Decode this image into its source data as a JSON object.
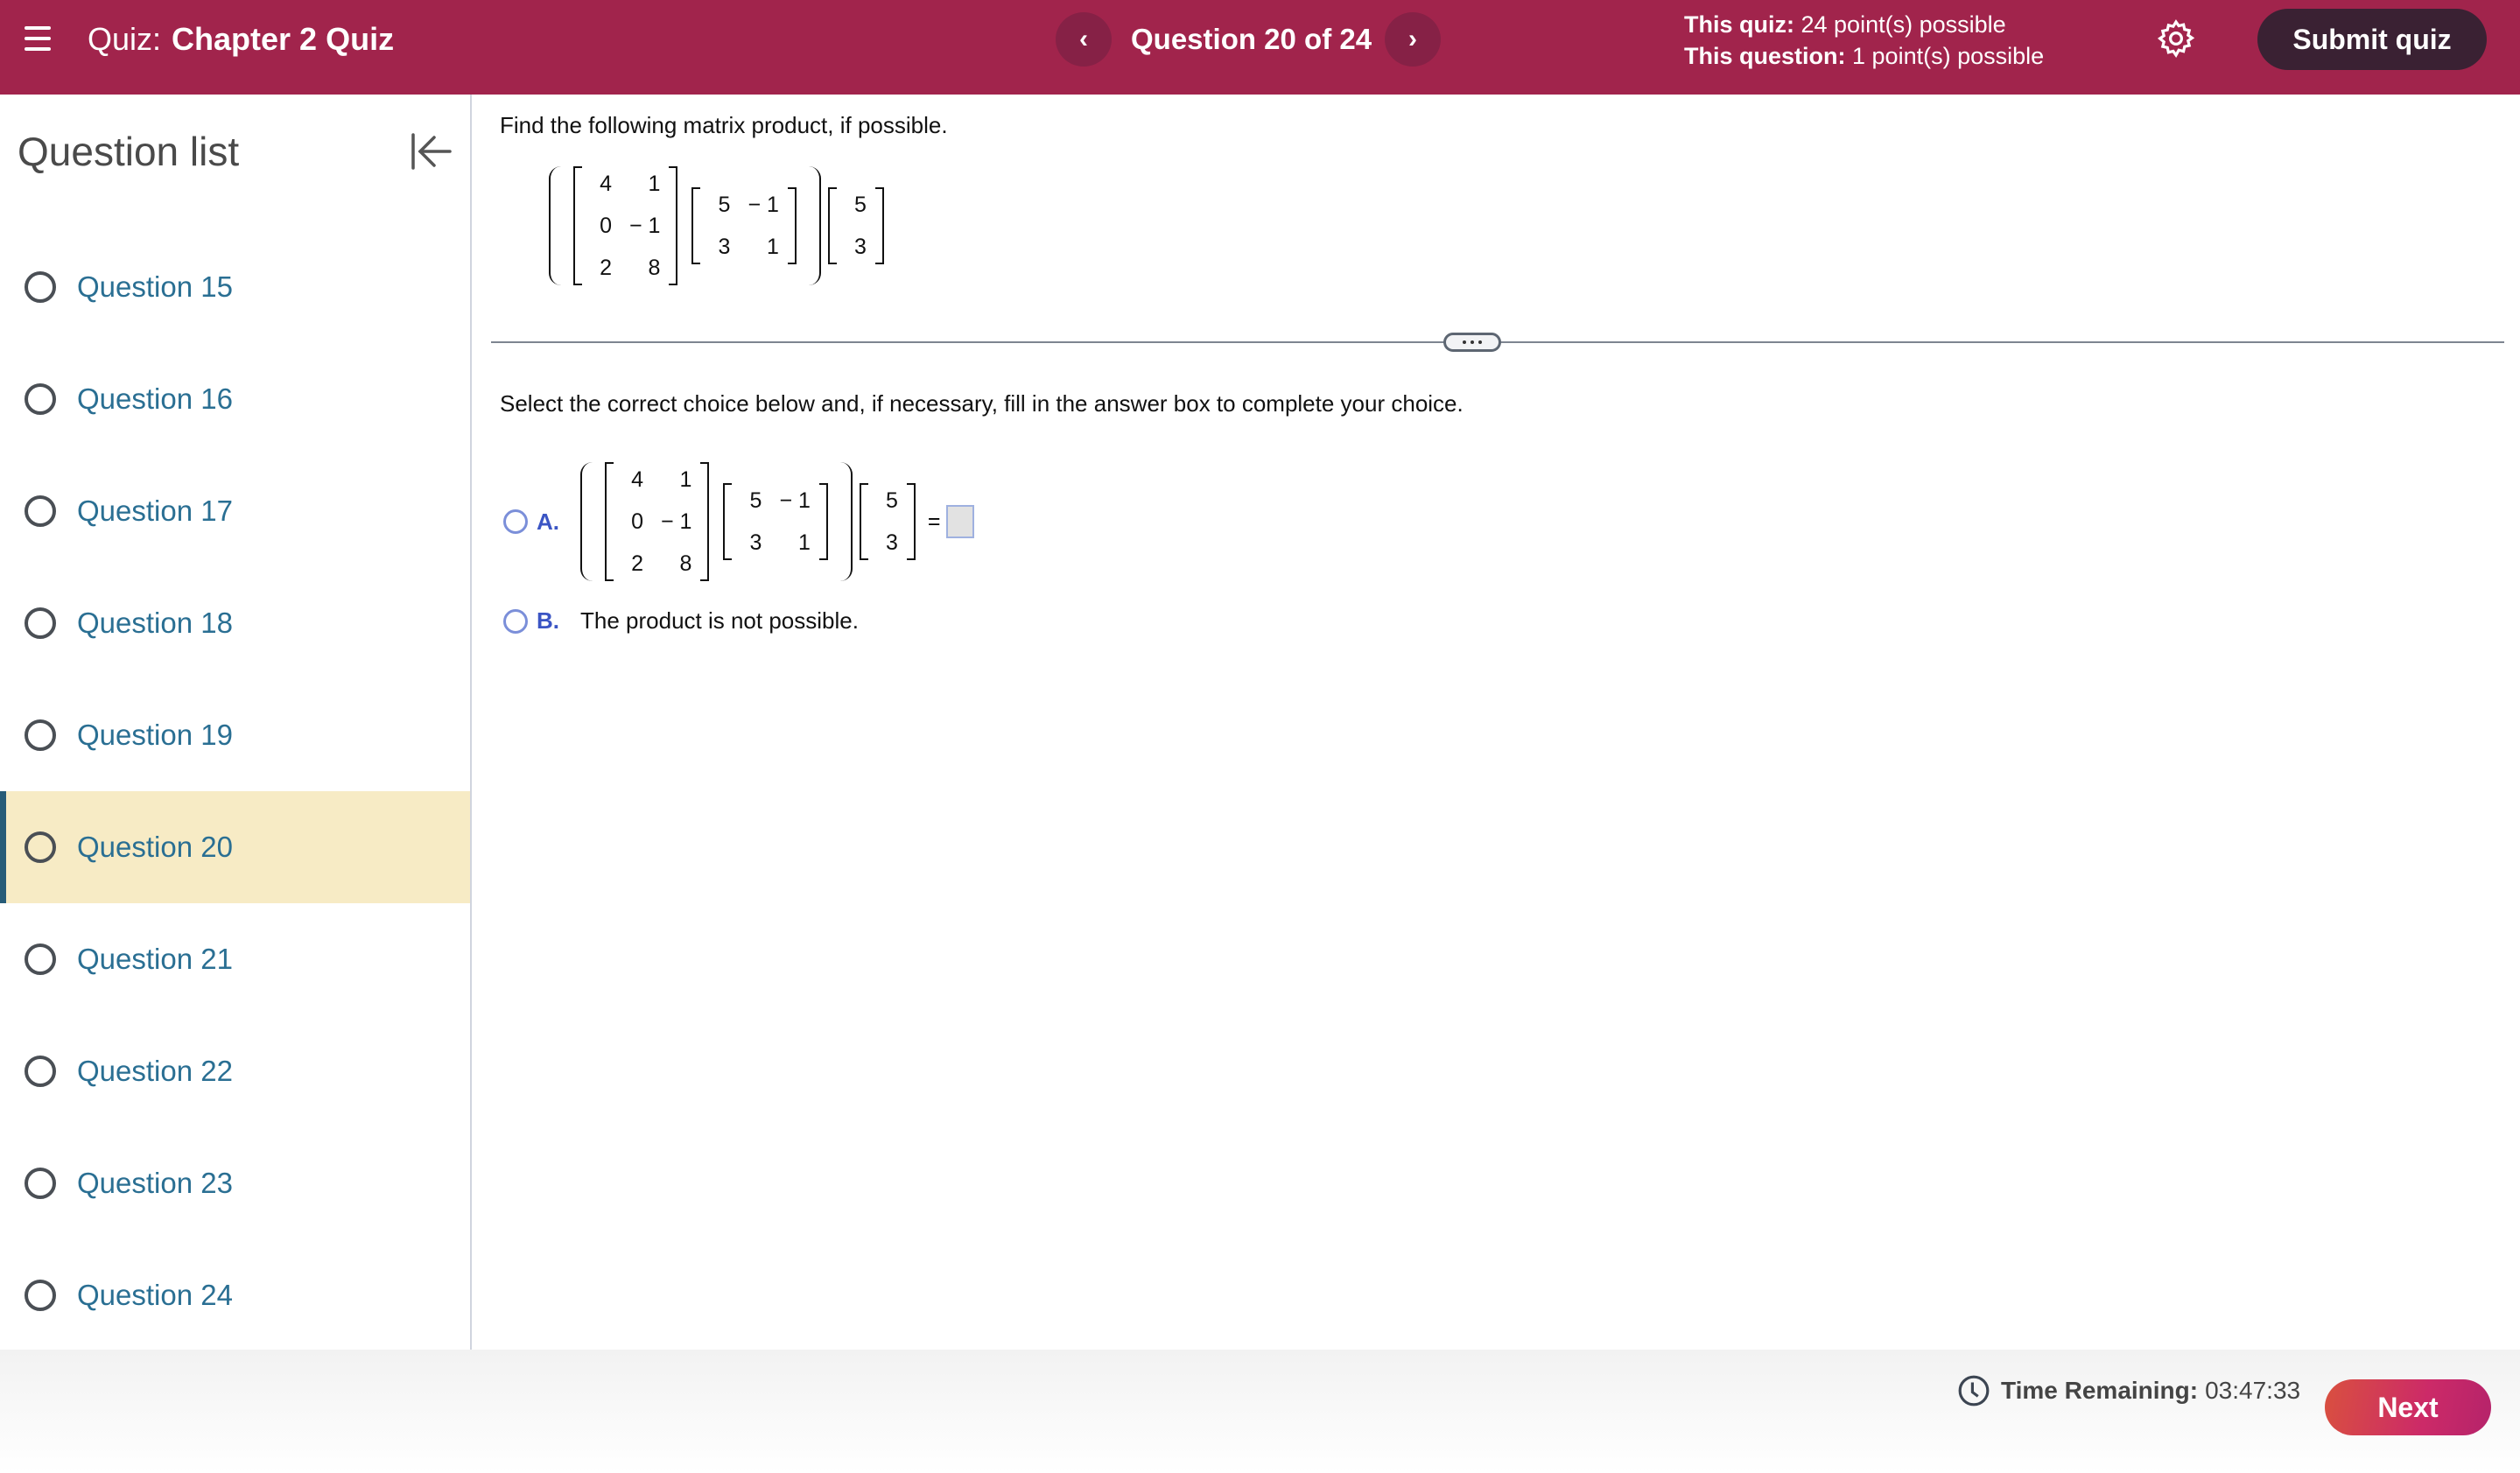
{
  "header": {
    "quiz_label": "Quiz:",
    "quiz_name": "Chapter 2 Quiz",
    "question_counter": "Question 20 of 24",
    "prev_glyph": "‹",
    "next_glyph": "›",
    "this_quiz_label": "This quiz:",
    "this_quiz_value": "24 point(s) possible",
    "this_question_label": "This question:",
    "this_question_value": "1 point(s) possible",
    "submit_label": "Submit quiz",
    "colors": {
      "bar": "#a1244c",
      "submit_bg": "#3a2133"
    }
  },
  "sidebar": {
    "title": "Question list",
    "items": [
      {
        "label": "Question 15",
        "active": false
      },
      {
        "label": "Question 16",
        "active": false
      },
      {
        "label": "Question 17",
        "active": false
      },
      {
        "label": "Question 18",
        "active": false
      },
      {
        "label": "Question 19",
        "active": false
      },
      {
        "label": "Question 20",
        "active": true
      },
      {
        "label": "Question 21",
        "active": false
      },
      {
        "label": "Question 22",
        "active": false
      },
      {
        "label": "Question 23",
        "active": false
      },
      {
        "label": "Question 24",
        "active": false
      }
    ]
  },
  "question": {
    "prompt": "Find the following matrix product, if possible.",
    "matrices": {
      "A": [
        [
          "4",
          "1"
        ],
        [
          "0",
          "− 1"
        ],
        [
          "2",
          "8"
        ]
      ],
      "B": [
        [
          "5",
          "− 1"
        ],
        [
          "3",
          "1"
        ]
      ],
      "C": [
        [
          "5"
        ],
        [
          "3"
        ]
      ]
    },
    "instruction": "Select the correct choice below and, if necessary, fill in the answer box to complete your choice.",
    "choices": [
      {
        "letter": "A.",
        "type": "expression",
        "equals": "=",
        "answer_value": ""
      },
      {
        "letter": "B.",
        "type": "text",
        "text": "The product is not possible."
      }
    ]
  },
  "footer": {
    "timer_label": "Time Remaining:",
    "timer_value": "03:47:33",
    "next_label": "Next"
  }
}
